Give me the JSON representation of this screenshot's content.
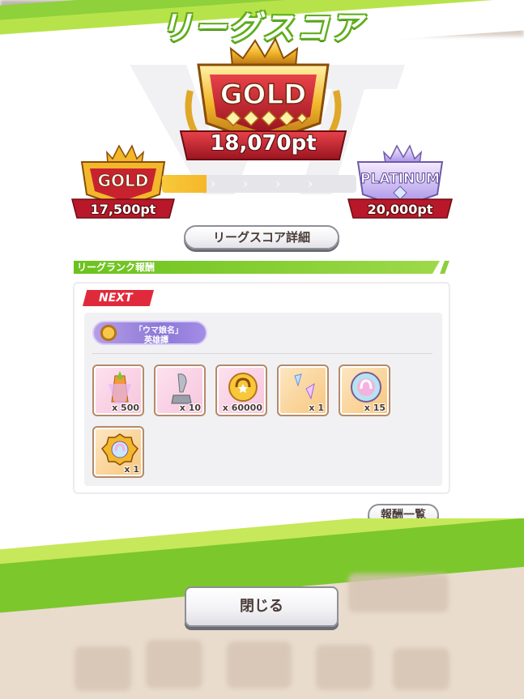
{
  "header": {
    "title": "リーグスコア"
  },
  "score": {
    "current_rank": "GOLD",
    "current_points": "18,070pt",
    "prev_rank": "GOLD",
    "prev_points": "17,500pt",
    "next_rank": "PLATINUM",
    "next_points": "20,000pt",
    "progress_fraction": 0.23
  },
  "buttons": {
    "detail": "リーグスコア詳細",
    "reward_list": "報酬一覧",
    "close": "閉じる"
  },
  "rewards": {
    "section_title": "リーグランク報酬",
    "next_label": "NEXT",
    "title_badge": {
      "line1": "「ウマ娘名」",
      "line2": "英雄譚"
    },
    "items": [
      {
        "name": "carrot-bouquet",
        "qty": "x 500",
        "bg": "pink"
      },
      {
        "name": "horseshoe-trophy",
        "qty": "x 10",
        "bg": "pink"
      },
      {
        "name": "gold-coin",
        "qty": "x 60000",
        "bg": "pink"
      },
      {
        "name": "crystal-shards",
        "qty": "x 1",
        "bg": "orange"
      },
      {
        "name": "rainbow-badge",
        "qty": "x 15",
        "bg": "orange"
      },
      {
        "name": "gold-gear-badge",
        "qty": "x 1",
        "bg": "orange"
      }
    ]
  },
  "colors": {
    "accent_green": "#7cc72c",
    "next_red": "#e02a3c",
    "gold": "#f5b72a"
  }
}
